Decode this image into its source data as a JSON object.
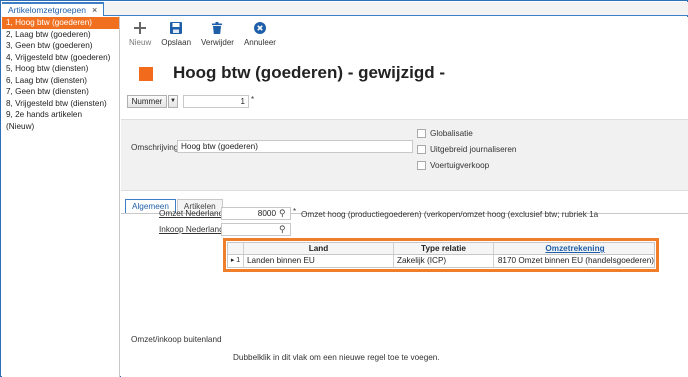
{
  "tab": {
    "title": "Artikelomzetgroepen",
    "close": "×"
  },
  "list": [
    "1, Hoog btw (goederen)",
    "2, Laag btw (goederen)",
    "3, Geen btw (goederen)",
    "4, Vrijgesteld btw (goederen)",
    "5, Hoog btw (diensten)",
    "6, Laag btw (diensten)",
    "7, Geen btw (diensten)",
    "8, Vrijgesteld btw (diensten)",
    "9, 2e hands artikelen",
    "(Nieuw)"
  ],
  "toolbar": {
    "new": "Nieuw",
    "save": "Opslaan",
    "delete": "Verwijder",
    "cancel": "Annuleer"
  },
  "title": "Hoog btw (goederen) - gewijzigd -",
  "nummer": {
    "label": "Nummer",
    "value": "1",
    "required": "*"
  },
  "omschrijving": {
    "label": "Omschrijving",
    "value": "Hoog btw (goederen)"
  },
  "checkboxes": {
    "globalisatie": "Globalisatie",
    "uitgebreid": "Uitgebreid journaliseren",
    "voertuig": "Voertuigverkoop"
  },
  "subtabs": {
    "algemeen": "Algemeen",
    "artikelen": "Artikelen"
  },
  "omzet": {
    "label": "Omzet Nederland",
    "value": "8000",
    "required": "*",
    "desc": "Omzet hoog (productiegoederen)  (verkopen/omzet hoog (exclusief btw; rubriek 1a"
  },
  "inkoop": {
    "label": "Inkoop Nederland",
    "value": ""
  },
  "grid": {
    "headers": {
      "land": "Land",
      "relatie": "Type relatie",
      "rekening": "Omzetrekening"
    },
    "row": {
      "marker": "▸ 1",
      "land": "Landen binnen EU",
      "relatie": "Zakelijk (ICP)",
      "rekening": "8170 Omzet binnen EU (handelsgoederen)"
    }
  },
  "buitenland_label": "Omzet/inkoop buitenland",
  "hint": "Dubbelklik in dit vlak om een  nieuwe regel toe te voegen.",
  "colors": {
    "accent": "#f07020",
    "link": "#1f5fa8",
    "frame": "#2e6fb8"
  }
}
